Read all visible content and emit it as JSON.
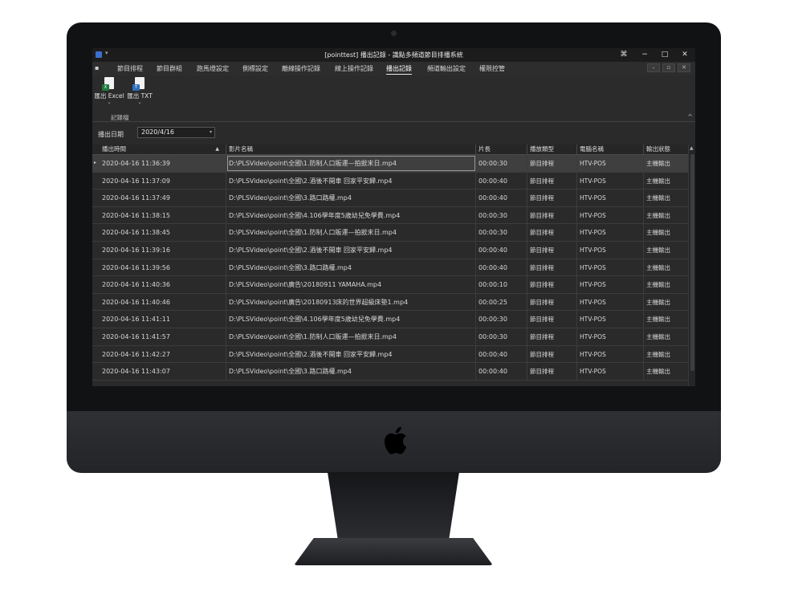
{
  "window": {
    "title": "[pointtest] 播出記錄 - 識點多頻道節目排播系統",
    "pin_glyph": "⌘",
    "minimize_glyph": "−",
    "maximize_glyph": "□",
    "close_glyph": "✕",
    "quick_access_glyph": "▾"
  },
  "ribbon": {
    "file_menu_glyph": "▪",
    "tabs": [
      {
        "label": "節目排程"
      },
      {
        "label": "節目群組"
      },
      {
        "label": "跑馬燈設定"
      },
      {
        "label": "側標設定"
      },
      {
        "label": "離線操作記錄"
      },
      {
        "label": "線上操作記錄"
      },
      {
        "label": "播出記錄"
      },
      {
        "label": "頻道輸出設定"
      },
      {
        "label": "權限控管"
      }
    ],
    "active_tab": "播出記錄",
    "mdi_buttons": [
      "–",
      "▫",
      "✕"
    ],
    "group_label": "記錄檔",
    "buttons": [
      {
        "label": "匯出 Excel",
        "icon": "excel-export-icon",
        "badge": "X",
        "color": "#1f7a3c"
      },
      {
        "label": "匯出 TXT",
        "icon": "txt-export-icon",
        "badge": "T",
        "color": "#2e6fbd"
      }
    ],
    "chevron_glyph": "⌄",
    "collapse_glyph": "^"
  },
  "filter": {
    "label": "播出日期",
    "date_value": "2020/4/16",
    "dropdown_glyph": "▾"
  },
  "grid": {
    "columns": [
      {
        "label": "播出時間"
      },
      {
        "label": "影片名稱"
      },
      {
        "label": "片長"
      },
      {
        "label": "播放類型"
      },
      {
        "label": "電腦名稱"
      },
      {
        "label": "輸出狀態"
      }
    ],
    "sort_glyph": "▲",
    "row_indicator_glyph": "▸",
    "scroll_up_glyph": "▲",
    "rows": [
      {
        "time": "2020-04-16 11:36:39",
        "file": "D:\\PLSVideo\\point\\全國\\1.防制人口販運—拍掀末日.mp4",
        "duration": "00:00:30",
        "type": "節目排程",
        "computer": "HTV-POS",
        "status": "主機輸出"
      },
      {
        "time": "2020-04-16 11:37:09",
        "file": "D:\\PLSVideo\\point\\全國\\2.酒後不開車  回家平安歸.mp4",
        "duration": "00:00:40",
        "type": "節目排程",
        "computer": "HTV-POS",
        "status": "主機輸出"
      },
      {
        "time": "2020-04-16 11:37:49",
        "file": "D:\\PLSVideo\\point\\全國\\3.路口路權.mp4",
        "duration": "00:00:40",
        "type": "節目排程",
        "computer": "HTV-POS",
        "status": "主機輸出"
      },
      {
        "time": "2020-04-16 11:38:15",
        "file": "D:\\PLSVideo\\point\\全國\\4.106學年度5歲幼兒免學費.mp4",
        "duration": "00:00:30",
        "type": "節目排程",
        "computer": "HTV-POS",
        "status": "主機輸出"
      },
      {
        "time": "2020-04-16 11:38:45",
        "file": "D:\\PLSVideo\\point\\全國\\1.防制人口販運—拍掀末日.mp4",
        "duration": "00:00:30",
        "type": "節目排程",
        "computer": "HTV-POS",
        "status": "主機輸出"
      },
      {
        "time": "2020-04-16 11:39:16",
        "file": "D:\\PLSVideo\\point\\全國\\2.酒後不開車  回家平安歸.mp4",
        "duration": "00:00:40",
        "type": "節目排程",
        "computer": "HTV-POS",
        "status": "主機輸出"
      },
      {
        "time": "2020-04-16 11:39:56",
        "file": "D:\\PLSVideo\\point\\全國\\3.路口路權.mp4",
        "duration": "00:00:40",
        "type": "節目排程",
        "computer": "HTV-POS",
        "status": "主機輸出"
      },
      {
        "time": "2020-04-16 11:40:36",
        "file": "D:\\PLSVideo\\point\\廣告\\20180911 YAMAHA.mp4",
        "duration": "00:00:10",
        "type": "節目排程",
        "computer": "HTV-POS",
        "status": "主機輸出"
      },
      {
        "time": "2020-04-16 11:40:46",
        "file": "D:\\PLSVideo\\point\\廣告\\20180913床的世界超級床墊1.mp4",
        "duration": "00:00:25",
        "type": "節目排程",
        "computer": "HTV-POS",
        "status": "主機輸出"
      },
      {
        "time": "2020-04-16 11:41:11",
        "file": "D:\\PLSVideo\\point\\全國\\4.106學年度5歲幼兒免學費.mp4",
        "duration": "00:00:30",
        "type": "節目排程",
        "computer": "HTV-POS",
        "status": "主機輸出"
      },
      {
        "time": "2020-04-16 11:41:57",
        "file": "D:\\PLSVideo\\point\\全國\\1.防制人口販運—拍掀末日.mp4",
        "duration": "00:00:30",
        "type": "節目排程",
        "computer": "HTV-POS",
        "status": "主機輸出"
      },
      {
        "time": "2020-04-16 11:42:27",
        "file": "D:\\PLSVideo\\point\\全國\\2.酒後不開車  回家平安歸.mp4",
        "duration": "00:00:40",
        "type": "節目排程",
        "computer": "HTV-POS",
        "status": "主機輸出"
      },
      {
        "time": "2020-04-16 11:43:07",
        "file": "D:\\PLSVideo\\point\\全國\\3.路口路權.mp4",
        "duration": "00:00:40",
        "type": "節目排程",
        "computer": "HTV-POS",
        "status": "主機輸出"
      }
    ]
  },
  "colors": {
    "screen_bg": "#2a2a2b",
    "selected_row": "#3f3f40",
    "bezel": "#111214"
  }
}
